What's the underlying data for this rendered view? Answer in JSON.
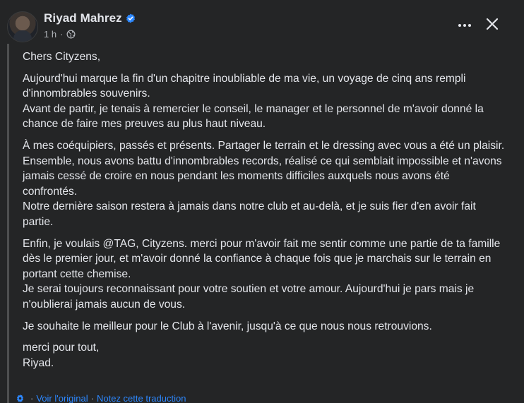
{
  "post": {
    "author": "Riyad Mahrez",
    "timestamp": "1 h",
    "meta_separator": "·",
    "paragraphs": [
      "Chers Cityzens,",
      "Aujourd'hui marque la fin d'un chapitre inoubliable de ma vie, un voyage de cinq ans rempli d'innombrables souvenirs.\nAvant de partir, je tenais à remercier le conseil, le manager et le personnel de m'avoir donné la chance de faire mes preuves au plus haut niveau.",
      "À mes coéquipiers, passés et présents. Partager le terrain et le dressing avec vous a été un plaisir.\nEnsemble, nous avons battu d'innombrables records, réalisé ce qui semblait impossible et n'avons jamais cessé de croire en nous pendant les moments difficiles auxquels nous avons été confrontés.\nNotre dernière saison restera à jamais dans notre club et au-delà, et je suis fier d'en avoir fait partie.",
      "Enfin, je voulais @TAG, Cityzens. merci pour m'avoir fait me sentir comme une partie de ta famille dès le premier jour, et m'avoir donné la confiance à chaque fois que je marchais sur le terrain en portant cette chemise.\nJe serai toujours reconnaissant pour votre soutien et votre amour. Aujourd'hui je pars mais je n'oublierai jamais aucun de vous.",
      "Je souhaite le meilleur pour le Club à l'avenir, jusqu'à ce que nous nous retrouvions.",
      "merci pour tout,\nRiyad."
    ]
  },
  "translation": {
    "separator": "·",
    "see_original": "Voir l'original",
    "rate_translation": "Notez cette traduction"
  },
  "colors": {
    "background": "#242526",
    "text": "#e4e6eb",
    "secondary_text": "#b0b3b8",
    "link": "#2d88ff",
    "verified": "#2d88ff"
  },
  "icons": {
    "verified": "verified-badge-icon",
    "audience": "globe-icon",
    "more": "more-options-icon",
    "close": "close-icon",
    "translation": "gear-icon"
  }
}
